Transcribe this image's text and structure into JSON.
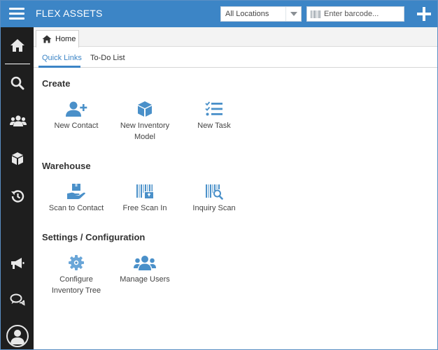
{
  "header": {
    "title": "FLEX ASSETS",
    "location_value": "All Locations",
    "barcode_placeholder": "Enter barcode..."
  },
  "sidebar": {
    "items": [
      {
        "icon": "home-icon"
      },
      {
        "icon": "search-icon"
      },
      {
        "icon": "users-icon"
      },
      {
        "icon": "cube-icon"
      },
      {
        "icon": "history-icon"
      },
      {
        "icon": "megaphone-icon"
      },
      {
        "icon": "chat-icon"
      },
      {
        "icon": "user-avatar-icon"
      }
    ]
  },
  "tabs": {
    "home_label": "Home"
  },
  "subtabs": {
    "quick_links": "Quick Links",
    "todo": "To-Do List"
  },
  "sections": {
    "create": {
      "title": "Create",
      "new_contact": "New Contact",
      "new_inventory_model_line1": "New Inventory",
      "new_inventory_model_line2": "Model",
      "new_task": "New Task"
    },
    "warehouse": {
      "title": "Warehouse",
      "scan_to_contact": "Scan to Contact",
      "free_scan_in": "Free Scan In",
      "inquiry_scan": "Inquiry Scan"
    },
    "settings": {
      "title": "Settings / Configuration",
      "configure_tree_line1": "Configure",
      "configure_tree_line2": "Inventory Tree",
      "manage_users": "Manage Users"
    }
  },
  "colors": {
    "brand": "#3c85c6",
    "sidebar": "#1e1e1e",
    "icon_blue": "#4a90c9"
  }
}
